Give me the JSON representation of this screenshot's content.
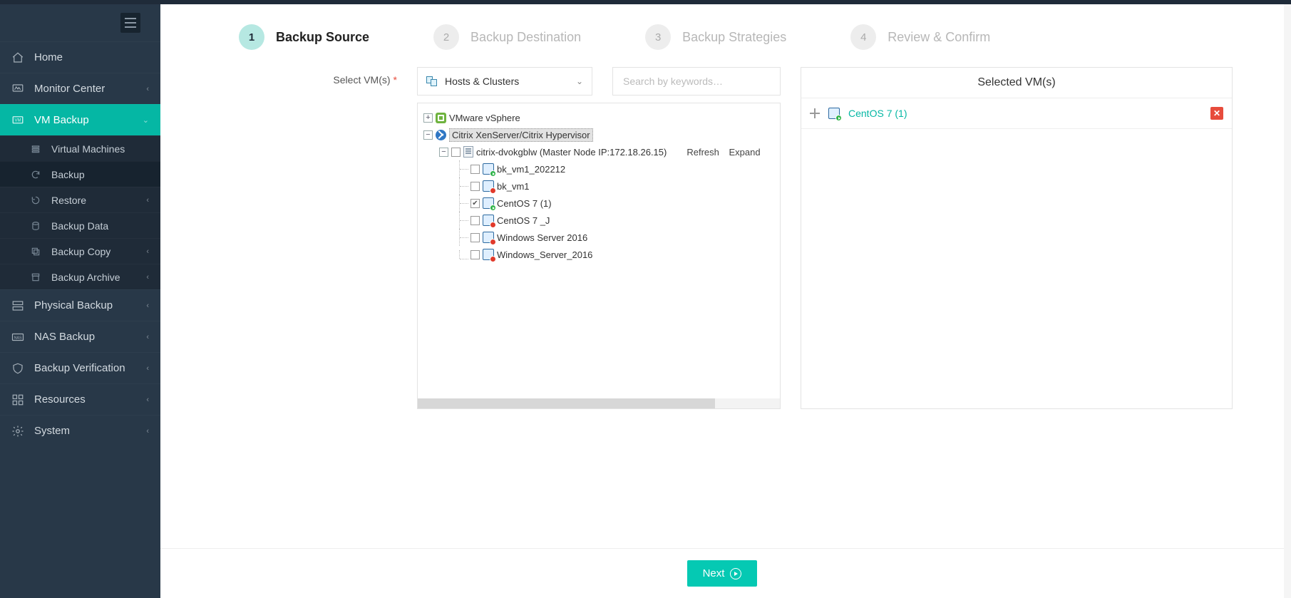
{
  "sidebar": {
    "items": [
      {
        "label": "Home"
      },
      {
        "label": "Monitor Center",
        "chevron": true
      },
      {
        "label": "VM Backup",
        "active": true,
        "chevron_down": true
      },
      {
        "label": "Physical Backup",
        "chevron": true
      },
      {
        "label": "NAS Backup",
        "chevron": true
      },
      {
        "label": "Backup Verification",
        "chevron": true
      },
      {
        "label": "Resources",
        "chevron": true
      },
      {
        "label": "System",
        "chevron": true
      }
    ],
    "vm_backup_sub": [
      {
        "label": "Virtual Machines"
      },
      {
        "label": "Backup",
        "current": true
      },
      {
        "label": "Restore",
        "chevron": true
      },
      {
        "label": "Backup Data"
      },
      {
        "label": "Backup Copy",
        "chevron": true
      },
      {
        "label": "Backup Archive",
        "chevron": true
      }
    ]
  },
  "wizard": {
    "steps": [
      {
        "num": "1",
        "name": "Backup Source",
        "active": true
      },
      {
        "num": "2",
        "name": "Backup Destination"
      },
      {
        "num": "3",
        "name": "Backup Strategies"
      },
      {
        "num": "4",
        "name": "Review & Confirm"
      }
    ]
  },
  "form": {
    "select_vms_label": "Select VM(s)",
    "view_dropdown": "Hosts & Clusters",
    "search_placeholder": "Search by keywords…"
  },
  "tree": {
    "root1": "VMware vSphere",
    "root2": "Citrix XenServer/Citrix Hypervisor",
    "host": "citrix-dvokgblw (Master Node IP:172.18.26.15)",
    "host_actions": {
      "refresh": "Refresh",
      "expand": "Expand"
    },
    "vms": [
      {
        "name": "bk_vm1_202212",
        "state": "green",
        "checked": false
      },
      {
        "name": "bk_vm1",
        "state": "red",
        "checked": false
      },
      {
        "name": "CentOS 7 (1)",
        "state": "green",
        "checked": true
      },
      {
        "name": "CentOS 7 _J",
        "state": "red",
        "checked": false
      },
      {
        "name": "Windows Server 2016",
        "state": "red",
        "checked": false
      },
      {
        "name": "Windows_Server_2016",
        "state": "red",
        "checked": false
      }
    ]
  },
  "selected_panel": {
    "title": "Selected VM(s)",
    "items": [
      {
        "name": "CentOS 7 (1)",
        "state": "green"
      }
    ]
  },
  "footer": {
    "next": "Next"
  }
}
